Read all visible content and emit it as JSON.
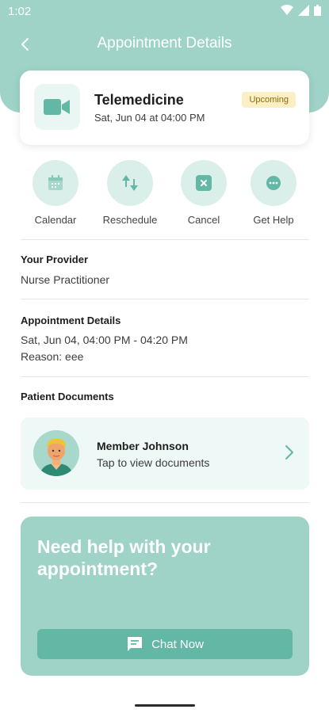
{
  "status_bar": {
    "time": "1:02"
  },
  "header": {
    "title": "Appointment Details"
  },
  "appointment": {
    "type": "Telemedicine",
    "datetime": "Sat, Jun 04 at 04:00 PM",
    "badge": "Upcoming",
    "icon": "video-camera-icon"
  },
  "actions": [
    {
      "label": "Calendar",
      "icon": "calendar-icon"
    },
    {
      "label": "Reschedule",
      "icon": "reschedule-icon"
    },
    {
      "label": "Cancel",
      "icon": "cancel-icon"
    },
    {
      "label": "Get Help",
      "icon": "chat-bubble-icon"
    }
  ],
  "provider": {
    "title": "Your Provider",
    "value": "Nurse Practitioner"
  },
  "details": {
    "title": "Appointment Details",
    "time": "Sat, Jun 04, 04:00 PM - 04:20 PM",
    "reason": "Reason: eee"
  },
  "documents": {
    "title": "Patient Documents",
    "member_name": "Member Johnson",
    "member_sub": "Tap to view documents"
  },
  "help": {
    "title": "Need help with your appointment?",
    "button": "Chat Now"
  },
  "colors": {
    "primary": "#9fd3c7",
    "accent": "#62b7a5",
    "badge_bg": "#fcefc4"
  }
}
